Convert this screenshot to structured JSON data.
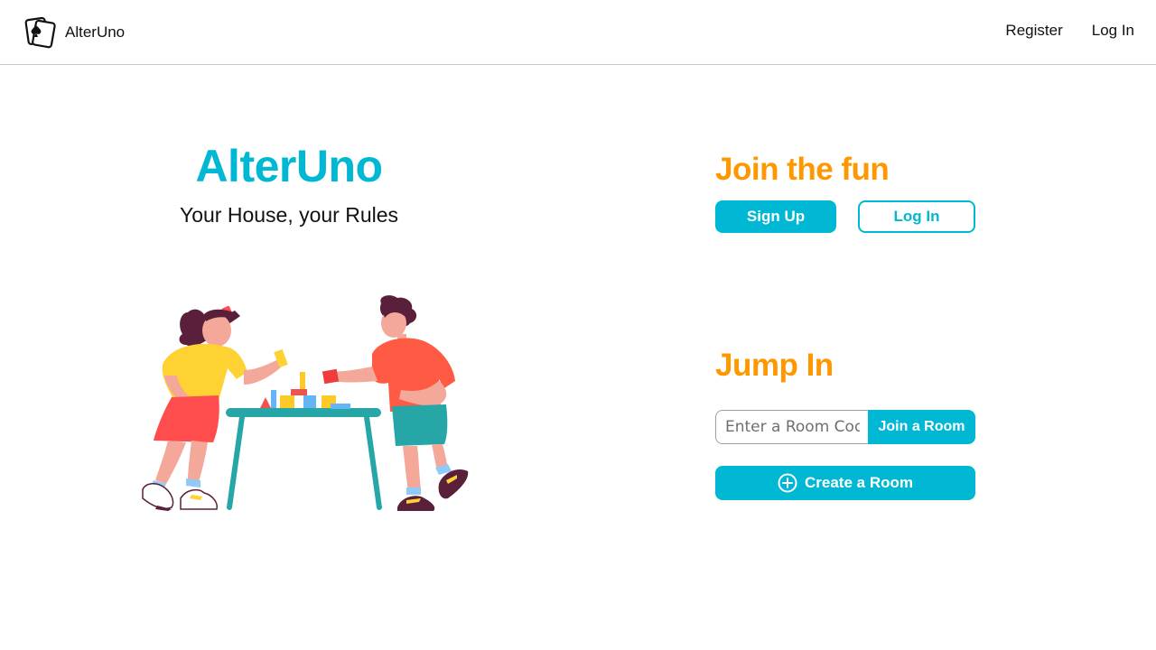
{
  "nav": {
    "brand_name": "AlterUno",
    "logo_icon": "playing-card-spade-icon",
    "links": [
      {
        "label": "Register"
      },
      {
        "label": "Log In"
      }
    ]
  },
  "hero": {
    "title": "AlterUno",
    "subtitle": "Your House, your Rules",
    "illustration_icon": "two-kids-playing-blocks-illustration"
  },
  "join": {
    "heading": "Join the fun",
    "signup_label": "Sign Up",
    "login_label": "Log In"
  },
  "jump": {
    "heading": "Jump In",
    "room_code_placeholder": "Enter a Room Code",
    "room_code_value": "",
    "join_label": "Join a Room",
    "create_label": "Create a Room",
    "create_icon": "plus-circle-icon"
  },
  "colors": {
    "accent": "#00b8d4",
    "heading": "#ff9800",
    "text": "#111111"
  }
}
